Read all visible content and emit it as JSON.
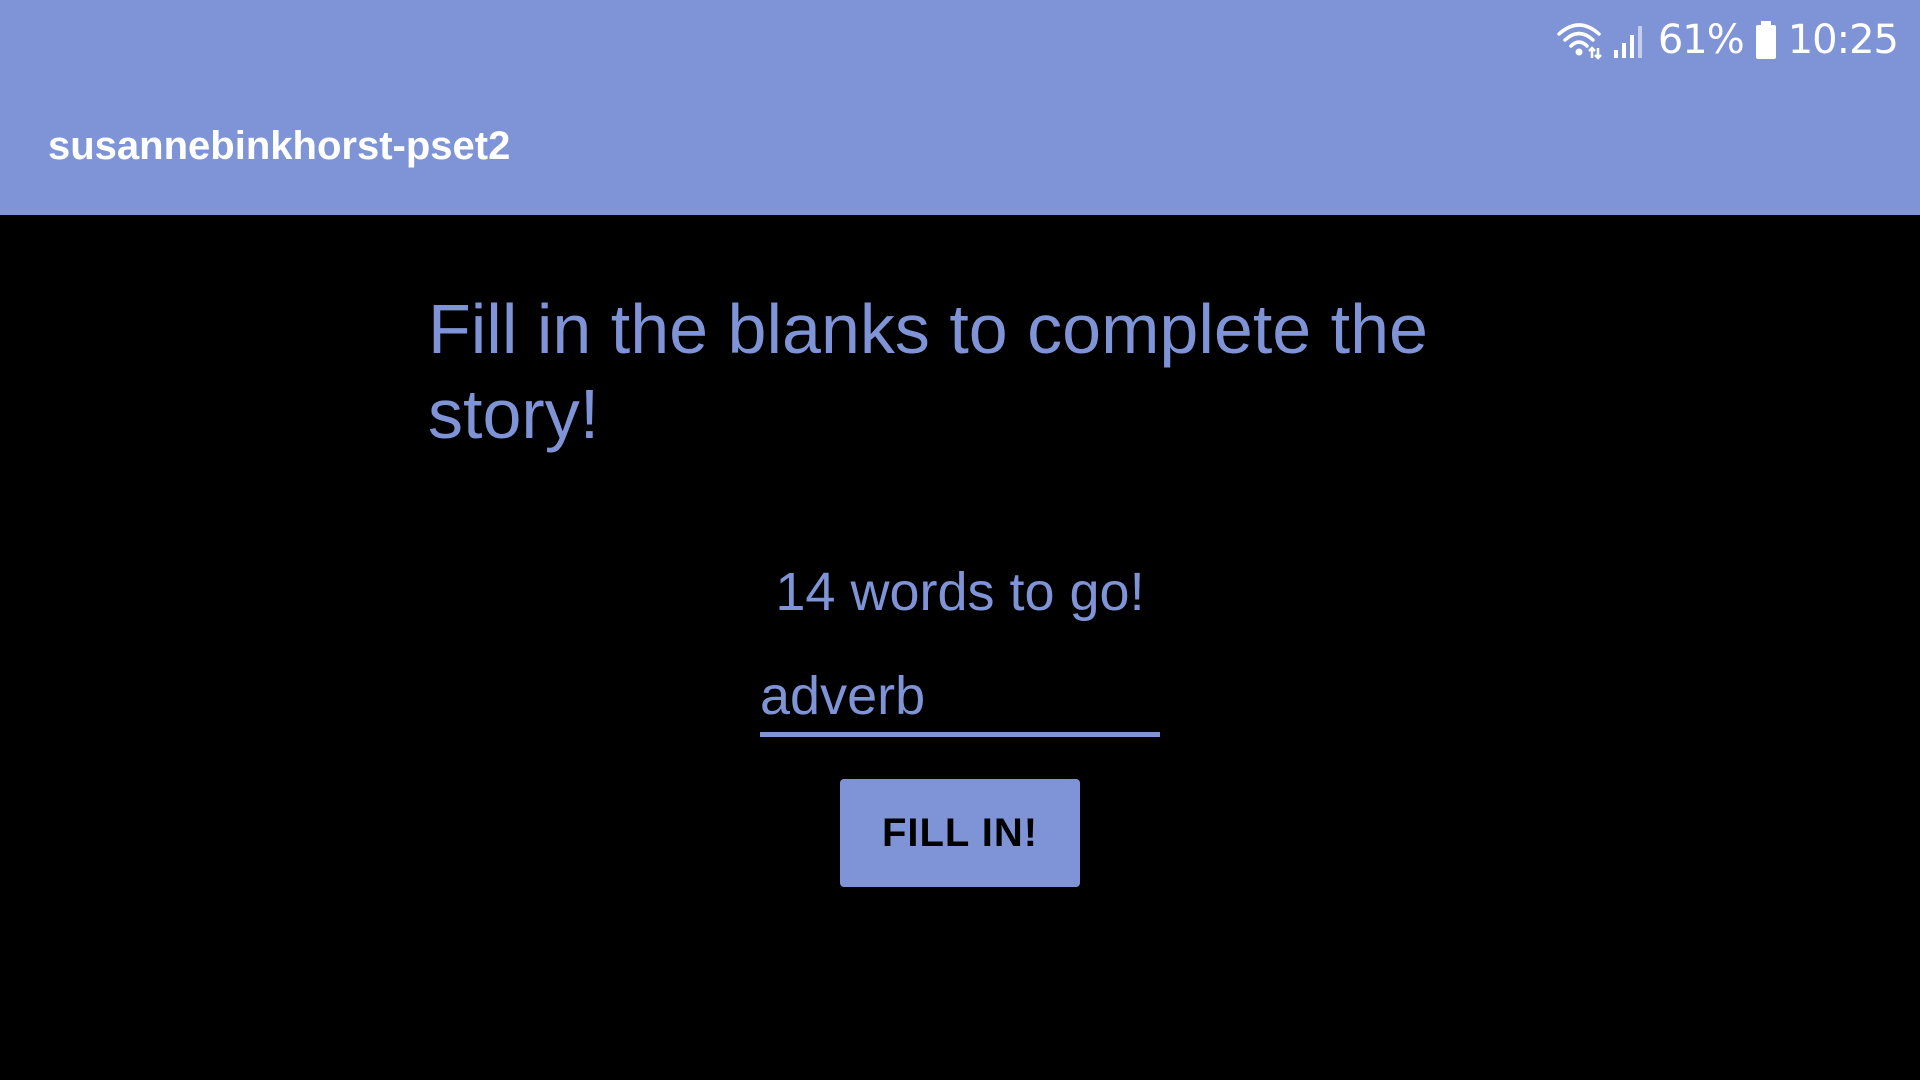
{
  "status_bar": {
    "battery": "61%",
    "time": "10:25",
    "icons": [
      "wifi-icon",
      "signal-icon",
      "battery-icon"
    ]
  },
  "app_bar": {
    "title": "susannebinkhorst-pset2"
  },
  "main": {
    "instruction": "Fill in the blanks to complete the story!",
    "counter": "14 words to go!",
    "input": {
      "value": "",
      "placeholder": "adverb"
    },
    "button_label": "FILL IN!"
  },
  "colors": {
    "accent": "#7f93d7",
    "background": "#000000",
    "app_bar_text": "#ffffff"
  }
}
